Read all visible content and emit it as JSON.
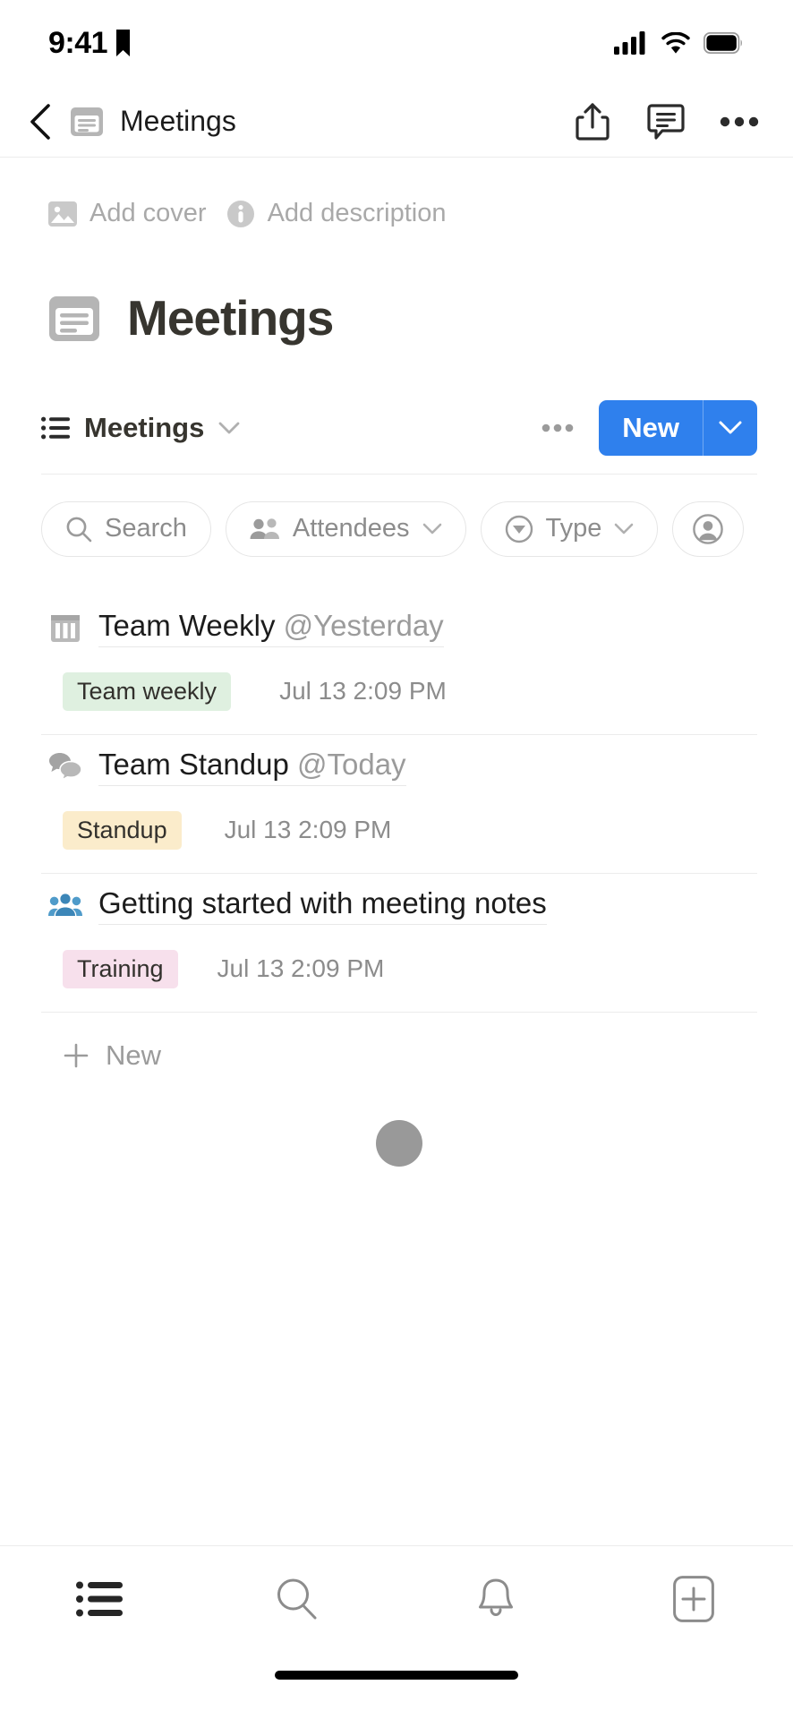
{
  "status_bar": {
    "time": "9:41",
    "bookmark_icon": "bookmark-icon",
    "cellular_icon": "cellular-signal-icon",
    "wifi_icon": "wifi-icon",
    "battery_icon": "battery-icon"
  },
  "nav_bar": {
    "back_icon": "chevron-left-icon",
    "doc_icon": "note-doc-icon",
    "title": "Meetings",
    "share_icon": "share-icon",
    "comment_icon": "comment-icon",
    "more_icon": "more-horizontal-icon"
  },
  "meta": {
    "add_cover_label": "Add cover",
    "add_cover_icon": "image-icon",
    "add_description_label": "Add description",
    "add_description_icon": "info-icon"
  },
  "page": {
    "icon": "note-doc-icon",
    "title": "Meetings"
  },
  "view_bar": {
    "view_icon": "list-view-icon",
    "view_name": "Meetings",
    "view_caret_icon": "chevron-down-icon",
    "more_icon": "more-horizontal-icon",
    "new_label": "New",
    "new_caret_icon": "chevron-down-icon",
    "accent_color": "#2f80ed"
  },
  "filters": [
    {
      "label": "Search",
      "icon": "search-icon",
      "has_caret": false
    },
    {
      "label": "Attendees",
      "icon": "people-icon",
      "has_caret": true
    },
    {
      "label": "Type",
      "icon": "circle-triangle-down-icon",
      "has_caret": true
    },
    {
      "label": "",
      "icon": "person-avatar-icon",
      "has_caret": false
    }
  ],
  "rows": [
    {
      "icon": "calendar-icon",
      "title": "Team Weekly ",
      "mention": "@Yesterday",
      "tag": "Team weekly",
      "tag_color": "#dff0e0",
      "date": "Jul 13 2:09 PM"
    },
    {
      "icon": "speech-bubbles-icon",
      "title": "Team Standup ",
      "mention": "@Today",
      "tag": "Standup",
      "tag_color": "#fbeccb",
      "date": "Jul 13 2:09 PM"
    },
    {
      "icon": "group-people-icon",
      "title": "Getting started with meeting notes",
      "mention": "",
      "tag": "Training",
      "tag_color": "#f7e0ec",
      "date": "Jul 13 2:09 PM"
    }
  ],
  "new_row": {
    "plus_icon": "plus-icon",
    "label": "New"
  },
  "loading": {
    "spinner_icon": "loading-spinner",
    "color": "#999999"
  },
  "tab_bar": [
    {
      "icon": "list-icon",
      "active": true
    },
    {
      "icon": "search-icon",
      "active": false
    },
    {
      "icon": "bell-icon",
      "active": false
    },
    {
      "icon": "plus-square-icon",
      "active": false
    }
  ]
}
